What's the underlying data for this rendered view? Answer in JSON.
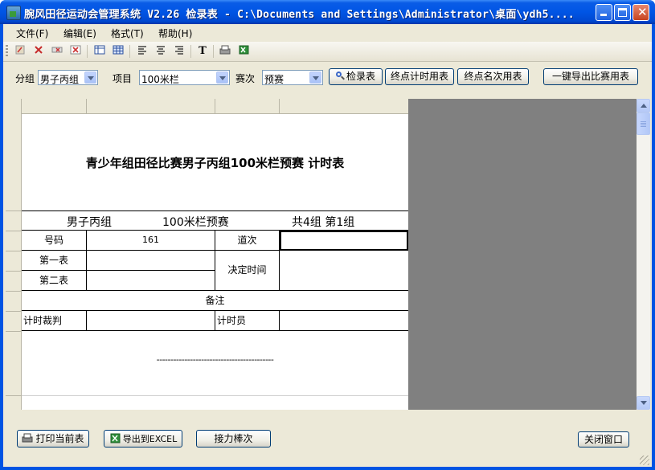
{
  "window": {
    "title": "腕风田径运动会管理系统 V2.26 检录表  - C:\\Documents and Settings\\Administrator\\桌面\\ydh5...."
  },
  "menu": [
    "文件(F)",
    "编辑(E)",
    "格式(T)",
    "帮助(H)"
  ],
  "toolbar_icons": [
    "cut-icon",
    "delete-icon",
    "move-icon",
    "clear-icon",
    "table-icon",
    "grid-icon",
    "align-left-icon",
    "align-center-icon",
    "align-right-icon",
    "text-icon",
    "print-icon",
    "excel-icon"
  ],
  "toolbar_text_glyph": "T",
  "filters": {
    "group_label": "分组",
    "group_value": "男子丙组",
    "event_label": "项目",
    "event_value": "100米栏",
    "round_label": "赛次",
    "round_value": "预赛"
  },
  "buttons": {
    "check_table": "检录表",
    "finish_timing": "终点计时用表",
    "finish_rank": "终点名次用表",
    "export_all": "一键导出比赛用表"
  },
  "sheet": {
    "title": "青少年组田径比赛男子丙组100米栏预赛 计时表",
    "info_group": "男子丙组",
    "info_event": "100米栏预赛",
    "info_heat": "共4组 第1组",
    "number_label": "号码",
    "number_value": "161",
    "lane_label": "道次",
    "first_watch_label": "第一表",
    "second_watch_label": "第二表",
    "final_time_label": "决定时间",
    "remarks_label": "备注",
    "timing_judge_label": "计时裁判",
    "timer_label": "计时员",
    "dashes": "------------------------------------------"
  },
  "bottom_buttons": {
    "print": "打印当前表",
    "export_excel": "导出到EXCEL",
    "relay": "接力棒次",
    "close": "关闭窗口"
  },
  "colors": {
    "titlebar": "#0055e5",
    "face": "#ece9d8",
    "grid_bg": "#808080"
  }
}
